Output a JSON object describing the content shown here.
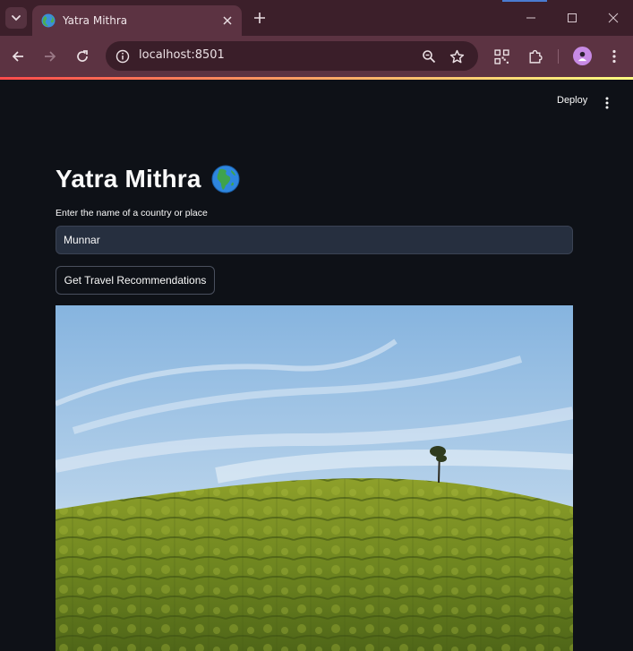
{
  "browser": {
    "tab": {
      "title": "Yatra Mithra",
      "favicon": "globe-icon"
    },
    "address_bar": {
      "url": "localhost:8501"
    },
    "icons": [
      "tab-search-icon",
      "close-icon",
      "plus-icon",
      "minimize-icon",
      "maximize-icon",
      "close-window-icon",
      "back-arrow-icon",
      "forward-arrow-icon",
      "reload-icon",
      "site-info-icon",
      "zoom-icon",
      "star-icon",
      "qr-code-icon",
      "extensions-icon",
      "profile-avatar",
      "more-vert-icon"
    ],
    "colors": {
      "frame": "#3c1f2a",
      "toolbar": "#5c3342",
      "omnibox": "#3a1e29"
    }
  },
  "app": {
    "header": {
      "deploy_label": "Deploy"
    },
    "title": "Yatra Mithra",
    "title_emoji": "globe-africa-icon",
    "input": {
      "label": "Enter the name of a country or place",
      "value": "Munnar"
    },
    "button": {
      "label": "Get Travel Recommendations"
    },
    "image": {
      "subject": "tea-plantation-hill"
    },
    "colors": {
      "background": "#0e1117",
      "input_bg": "#262f3f",
      "text": "#fafafa",
      "accent_gradient": [
        "#ff4b4b",
        "#fffd80"
      ]
    }
  }
}
